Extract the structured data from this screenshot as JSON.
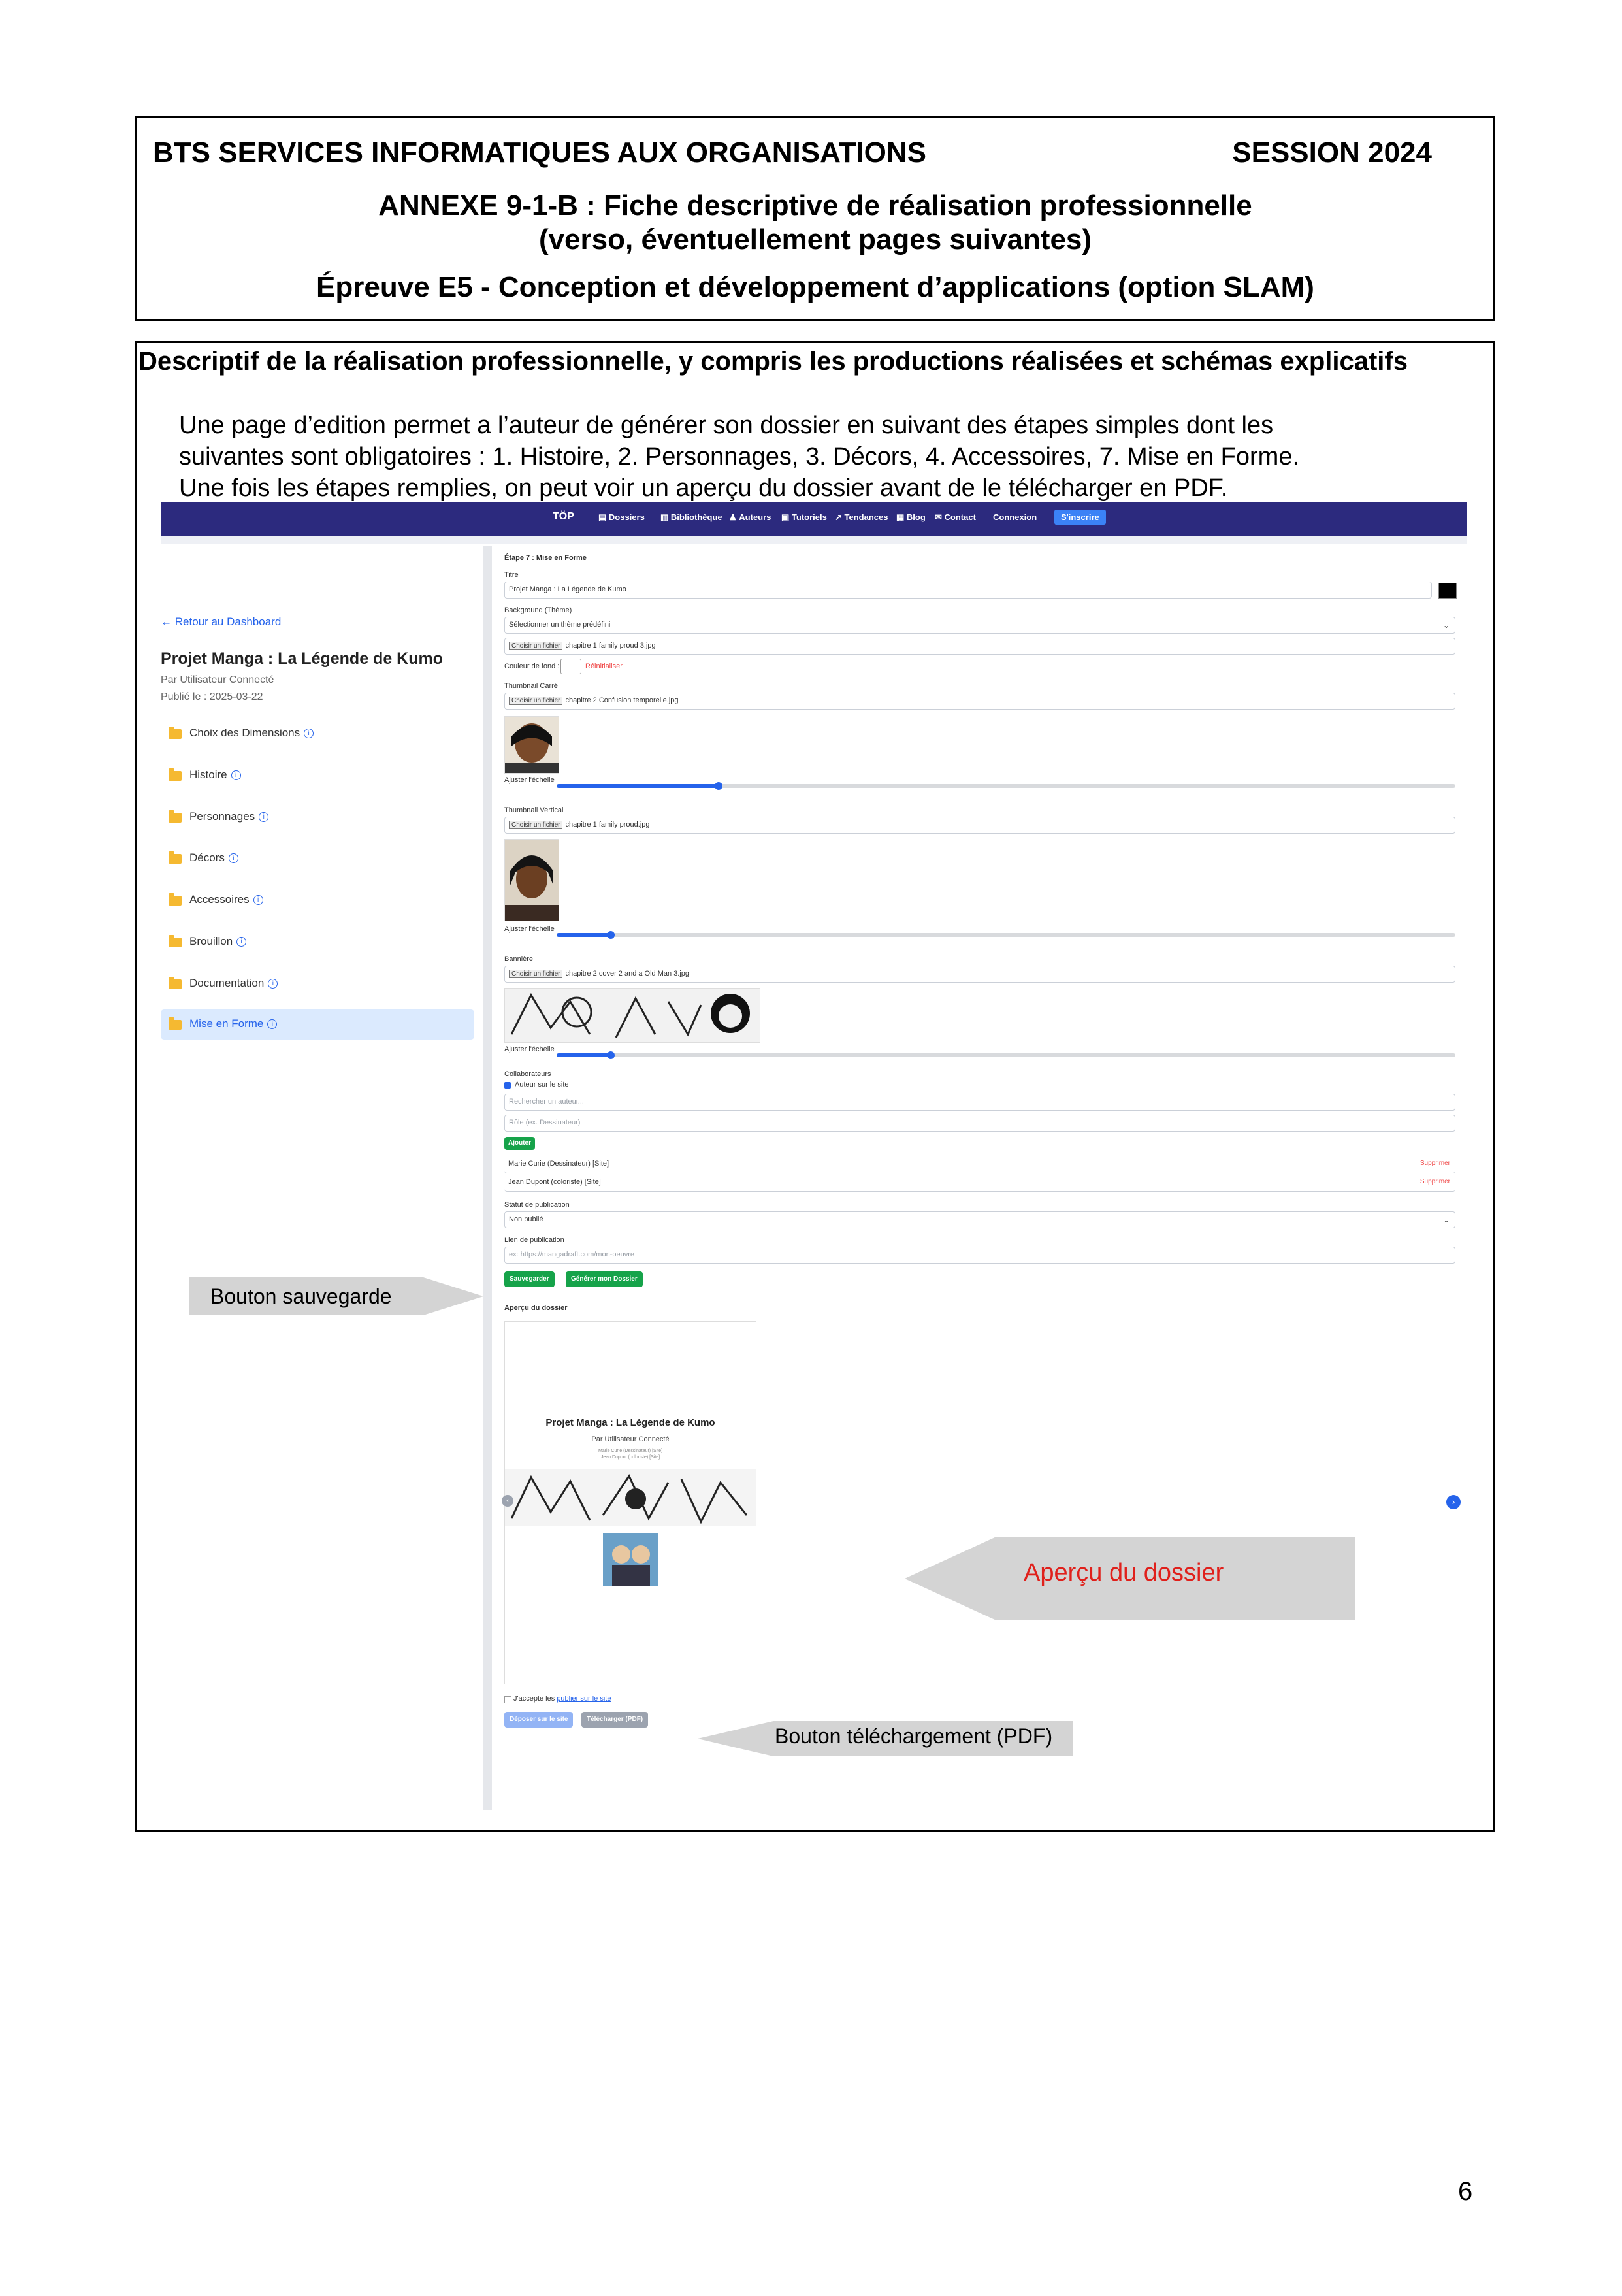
{
  "header": {
    "line1_left": "BTS SERVICES INFORMATIQUES AUX ORGANISATIONS",
    "line1_right": "SESSION 2024",
    "line2a": "ANNEXE 9-1-B : Fiche descriptive de réalisation professionnelle",
    "line2b": "(verso, éventuellement pages suivantes)",
    "line3": "Épreuve E5 - Conception et développement d’applications (option SLAM)"
  },
  "section": {
    "title": "Descriptif de la réalisation professionnelle, y compris les productions réalisées et schémas explicatifs",
    "intro": [
      "Une page d’edition permet a l’auteur de générer son dossier en suivant des étapes simples dont les",
      "suivantes sont obligatoires : 1. Histoire, 2. Personnages, 3. Décors, 4. Accessoires, 7. Mise en Forme.",
      "Une fois les étapes remplies, on peut voir un aperçu du dossier avant de le télécharger en PDF."
    ]
  },
  "nav": {
    "logo": "TÖP",
    "items": [
      "Dossiers",
      "Bibliothèque",
      "Auteurs",
      "Tutoriels",
      "Tendances",
      "Blog",
      "Contact",
      "Connexion"
    ],
    "signup": "S'inscrire"
  },
  "sidebar": {
    "back": "Retour au Dashboard",
    "project_title": "Projet Manga : La Légende de Kumo",
    "author": "Par Utilisateur Connecté",
    "published": "Publié le : 2025-03-22",
    "items": [
      {
        "label": "Choix des Dimensions",
        "active": false
      },
      {
        "label": "Histoire",
        "active": false
      },
      {
        "label": "Personnages",
        "active": false
      },
      {
        "label": "Décors",
        "active": false
      },
      {
        "label": "Accessoires",
        "active": false
      },
      {
        "label": "Brouillon",
        "active": false
      },
      {
        "label": "Documentation",
        "active": false
      },
      {
        "label": "Mise en Forme",
        "active": true
      }
    ]
  },
  "form": {
    "step": "Étape 7 : Mise en Forme",
    "title_label": "Titre",
    "title_value": "Projet Manga : La Légende de Kumo",
    "background_label": "Background (Thème)",
    "background_value": "Sélectionner un thème prédéfini",
    "file_button": "Choisir un fichier",
    "background_file": "chapitre 1 family proud 3.jpg",
    "bg_color_label": "Couleur de fond :",
    "reinit": "Réinitialiser",
    "square_label": "Thumbnail Carré",
    "square_file": "chapitre 2 Confusion temporelle.jpg",
    "scale_label": "Ajuster l'échelle",
    "scale_square": 0.18,
    "vertical_label": "Thumbnail Vertical",
    "vertical_file": "chapitre 1 family proud.jpg",
    "scale_vertical": 0.06,
    "banner_label": "Bannière",
    "banner_file": "chapitre 2 cover 2 and a Old Man 3.jpg",
    "scale_banner": 0.06,
    "collab_label": "Collaborateurs",
    "collab_checkbox": "Auteur sur le site",
    "search_placeholder": "Rechercher un auteur...",
    "role_placeholder": "Rôle (ex. Dessinateur)",
    "add_button": "Ajouter",
    "collaborators": [
      {
        "name": "Marie Curie (Dessinateur) [Site]",
        "remove": "Supprimer"
      },
      {
        "name": "Jean Dupont (coloriste) [Site]",
        "remove": "Supprimer"
      }
    ],
    "status_label": "Statut de publication",
    "status_value": "Non publié",
    "link_label": "Lien de publication",
    "link_placeholder": "ex: https://mangadraft.com/mon-oeuvre",
    "save_button": "Sauvegarder",
    "generate_button": "Générer mon Dossier",
    "preview_label": "Aperçu du dossier",
    "preview_title": "Projet Manga : La Légende de Kumo",
    "preview_author": "Par Utilisateur Connecté",
    "preview_collab1": "Marie Curie (Dessinateur) [Site]",
    "preview_collab2": "Jean Dupont (coloriste) [Site]",
    "accept_prefix": "J'accepte les",
    "accept_link": "publier sur le site",
    "publish_button": "Déposer sur le site",
    "download_button": "Télécharger (PDF)"
  },
  "annotations": {
    "save": "Bouton sauvegarde",
    "preview": "Aperçu du dossier",
    "download": "Bouton téléchargement (PDF)"
  },
  "colors": {
    "nav_bg": "#2c2a7e",
    "accent": "#2563eb",
    "green": "#16a34a",
    "annotation_red": "#e0201b"
  },
  "page_number": "6"
}
